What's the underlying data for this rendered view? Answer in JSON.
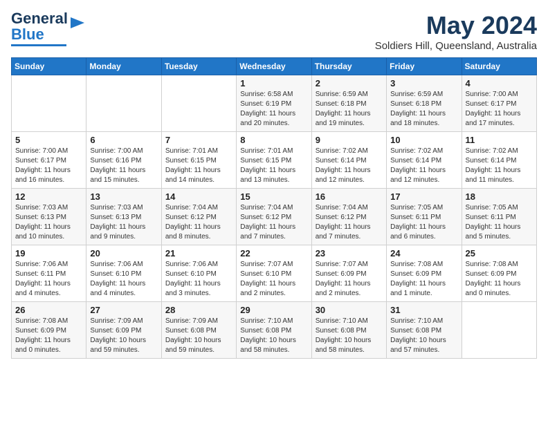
{
  "header": {
    "logo_line1": "General",
    "logo_line2": "Blue",
    "month_year": "May 2024",
    "location": "Soldiers Hill, Queensland, Australia"
  },
  "days_of_week": [
    "Sunday",
    "Monday",
    "Tuesday",
    "Wednesday",
    "Thursday",
    "Friday",
    "Saturday"
  ],
  "weeks": [
    [
      {
        "day": "",
        "content": ""
      },
      {
        "day": "",
        "content": ""
      },
      {
        "day": "",
        "content": ""
      },
      {
        "day": "1",
        "content": "Sunrise: 6:58 AM\nSunset: 6:19 PM\nDaylight: 11 hours\nand 20 minutes."
      },
      {
        "day": "2",
        "content": "Sunrise: 6:59 AM\nSunset: 6:18 PM\nDaylight: 11 hours\nand 19 minutes."
      },
      {
        "day": "3",
        "content": "Sunrise: 6:59 AM\nSunset: 6:18 PM\nDaylight: 11 hours\nand 18 minutes."
      },
      {
        "day": "4",
        "content": "Sunrise: 7:00 AM\nSunset: 6:17 PM\nDaylight: 11 hours\nand 17 minutes."
      }
    ],
    [
      {
        "day": "5",
        "content": "Sunrise: 7:00 AM\nSunset: 6:17 PM\nDaylight: 11 hours\nand 16 minutes."
      },
      {
        "day": "6",
        "content": "Sunrise: 7:00 AM\nSunset: 6:16 PM\nDaylight: 11 hours\nand 15 minutes."
      },
      {
        "day": "7",
        "content": "Sunrise: 7:01 AM\nSunset: 6:15 PM\nDaylight: 11 hours\nand 14 minutes."
      },
      {
        "day": "8",
        "content": "Sunrise: 7:01 AM\nSunset: 6:15 PM\nDaylight: 11 hours\nand 13 minutes."
      },
      {
        "day": "9",
        "content": "Sunrise: 7:02 AM\nSunset: 6:14 PM\nDaylight: 11 hours\nand 12 minutes."
      },
      {
        "day": "10",
        "content": "Sunrise: 7:02 AM\nSunset: 6:14 PM\nDaylight: 11 hours\nand 12 minutes."
      },
      {
        "day": "11",
        "content": "Sunrise: 7:02 AM\nSunset: 6:14 PM\nDaylight: 11 hours\nand 11 minutes."
      }
    ],
    [
      {
        "day": "12",
        "content": "Sunrise: 7:03 AM\nSunset: 6:13 PM\nDaylight: 11 hours\nand 10 minutes."
      },
      {
        "day": "13",
        "content": "Sunrise: 7:03 AM\nSunset: 6:13 PM\nDaylight: 11 hours\nand 9 minutes."
      },
      {
        "day": "14",
        "content": "Sunrise: 7:04 AM\nSunset: 6:12 PM\nDaylight: 11 hours\nand 8 minutes."
      },
      {
        "day": "15",
        "content": "Sunrise: 7:04 AM\nSunset: 6:12 PM\nDaylight: 11 hours\nand 7 minutes."
      },
      {
        "day": "16",
        "content": "Sunrise: 7:04 AM\nSunset: 6:12 PM\nDaylight: 11 hours\nand 7 minutes."
      },
      {
        "day": "17",
        "content": "Sunrise: 7:05 AM\nSunset: 6:11 PM\nDaylight: 11 hours\nand 6 minutes."
      },
      {
        "day": "18",
        "content": "Sunrise: 7:05 AM\nSunset: 6:11 PM\nDaylight: 11 hours\nand 5 minutes."
      }
    ],
    [
      {
        "day": "19",
        "content": "Sunrise: 7:06 AM\nSunset: 6:11 PM\nDaylight: 11 hours\nand 4 minutes."
      },
      {
        "day": "20",
        "content": "Sunrise: 7:06 AM\nSunset: 6:10 PM\nDaylight: 11 hours\nand 4 minutes."
      },
      {
        "day": "21",
        "content": "Sunrise: 7:06 AM\nSunset: 6:10 PM\nDaylight: 11 hours\nand 3 minutes."
      },
      {
        "day": "22",
        "content": "Sunrise: 7:07 AM\nSunset: 6:10 PM\nDaylight: 11 hours\nand 2 minutes."
      },
      {
        "day": "23",
        "content": "Sunrise: 7:07 AM\nSunset: 6:09 PM\nDaylight: 11 hours\nand 2 minutes."
      },
      {
        "day": "24",
        "content": "Sunrise: 7:08 AM\nSunset: 6:09 PM\nDaylight: 11 hours\nand 1 minute."
      },
      {
        "day": "25",
        "content": "Sunrise: 7:08 AM\nSunset: 6:09 PM\nDaylight: 11 hours\nand 0 minutes."
      }
    ],
    [
      {
        "day": "26",
        "content": "Sunrise: 7:08 AM\nSunset: 6:09 PM\nDaylight: 11 hours\nand 0 minutes."
      },
      {
        "day": "27",
        "content": "Sunrise: 7:09 AM\nSunset: 6:09 PM\nDaylight: 10 hours\nand 59 minutes."
      },
      {
        "day": "28",
        "content": "Sunrise: 7:09 AM\nSunset: 6:08 PM\nDaylight: 10 hours\nand 59 minutes."
      },
      {
        "day": "29",
        "content": "Sunrise: 7:10 AM\nSunset: 6:08 PM\nDaylight: 10 hours\nand 58 minutes."
      },
      {
        "day": "30",
        "content": "Sunrise: 7:10 AM\nSunset: 6:08 PM\nDaylight: 10 hours\nand 58 minutes."
      },
      {
        "day": "31",
        "content": "Sunrise: 7:10 AM\nSunset: 6:08 PM\nDaylight: 10 hours\nand 57 minutes."
      },
      {
        "day": "",
        "content": ""
      }
    ]
  ]
}
